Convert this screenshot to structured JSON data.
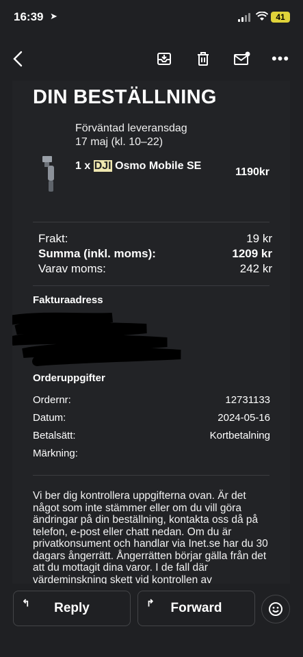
{
  "status": {
    "time": "16:39",
    "battery": "41"
  },
  "email": {
    "title": "DIN BESTÄLLNING",
    "delivery_line1": "Förväntad leveransdag",
    "delivery_line2": "17 maj (kl. 10–22)",
    "product_prefix": "1 x",
    "product_brand": "DJI",
    "product_rest": "Osmo Mobile SE",
    "product_price": "1190kr",
    "summary": [
      {
        "label": "Frakt:",
        "value": "19 kr"
      },
      {
        "label": "Summa (inkl. moms):",
        "value": "1209 kr"
      },
      {
        "label": "Varav moms:",
        "value": "242 kr"
      }
    ],
    "invoice_heading": "Fakturaadress",
    "order_heading": "Orderuppgifter",
    "order_details": [
      {
        "label": "Ordernr:",
        "value": "12731133"
      },
      {
        "label": "Datum:",
        "value": "2024-05-16"
      },
      {
        "label": "Betalsätt:",
        "value": "Kortbetalning"
      },
      {
        "label": "Märkning:",
        "value": ""
      }
    ],
    "paragraph": "Vi ber dig kontrollera uppgifterna ovan. Är det något som inte stämmer eller om du vill göra ändringar på din beställning, kontakta oss då på telefon, e-post eller chatt nedan. Om du är privatkonsument och handlar via Inet.se har du 30 dagars ångerrätt. Ångerrätten börjar gälla från det att du mottagit dina varor. I de fall där värdeminskning skett vid kontrollen av"
  },
  "actions": {
    "reply": "Reply",
    "forward": "Forward"
  },
  "icons": {
    "back": "chevron-left-icon",
    "archive": "archive-icon",
    "trash": "trash-icon",
    "mail": "mark-unread-icon",
    "more": "more-icon",
    "emoji": "emoji-icon"
  },
  "colors": {
    "background": "#1f2023",
    "card": "#222326",
    "highlight": "#efe7b0",
    "battery": "#e0d33a"
  }
}
